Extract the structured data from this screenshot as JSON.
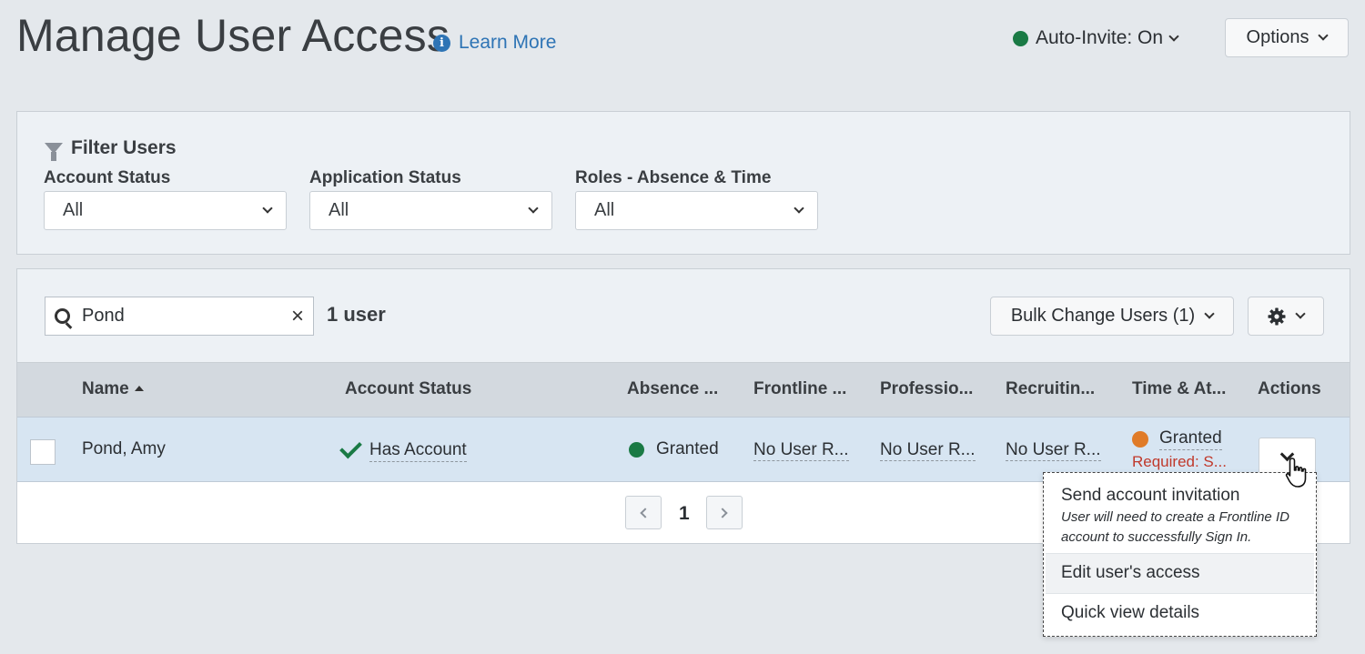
{
  "header": {
    "title": "Manage User Access",
    "learn_more": "Learn More",
    "auto_invite": "Auto-Invite: On",
    "options": "Options"
  },
  "filters": {
    "title": "Filter Users",
    "groups": [
      {
        "label": "Account Status",
        "value": "All"
      },
      {
        "label": "Application Status",
        "value": "All"
      },
      {
        "label": "Roles - Absence & Time",
        "value": "All"
      }
    ]
  },
  "toolbar": {
    "search_value": "Pond",
    "user_count": "1 user",
    "bulk_change": "Bulk Change Users (1)"
  },
  "table": {
    "columns": [
      "Name",
      "Account Status",
      "Absence ...",
      "Frontline ...",
      "Professio...",
      "Recruitin...",
      "Time & At...",
      "Actions"
    ],
    "rows": [
      {
        "name": "Pond, Amy",
        "account_status": "Has Account",
        "absence": "Granted",
        "frontline": "No User R...",
        "professional": "No User R...",
        "recruiting": "No User R...",
        "time_attendance": "Granted",
        "time_attendance_note": "Required: S..."
      }
    ]
  },
  "pagination": {
    "current": "1"
  },
  "actions_menu": {
    "items": [
      {
        "label": "Send account invitation",
        "sub": "User will need to create a Frontline ID account to successfully Sign In."
      },
      {
        "label": "Edit user's access"
      },
      {
        "label": "Quick view details"
      }
    ]
  },
  "colors": {
    "accent": "#2e74b5",
    "granted_green": "#1a7a45",
    "pending_orange": "#e07b28",
    "required_red": "#c0392b",
    "row_selected": "#d7e5f2"
  }
}
